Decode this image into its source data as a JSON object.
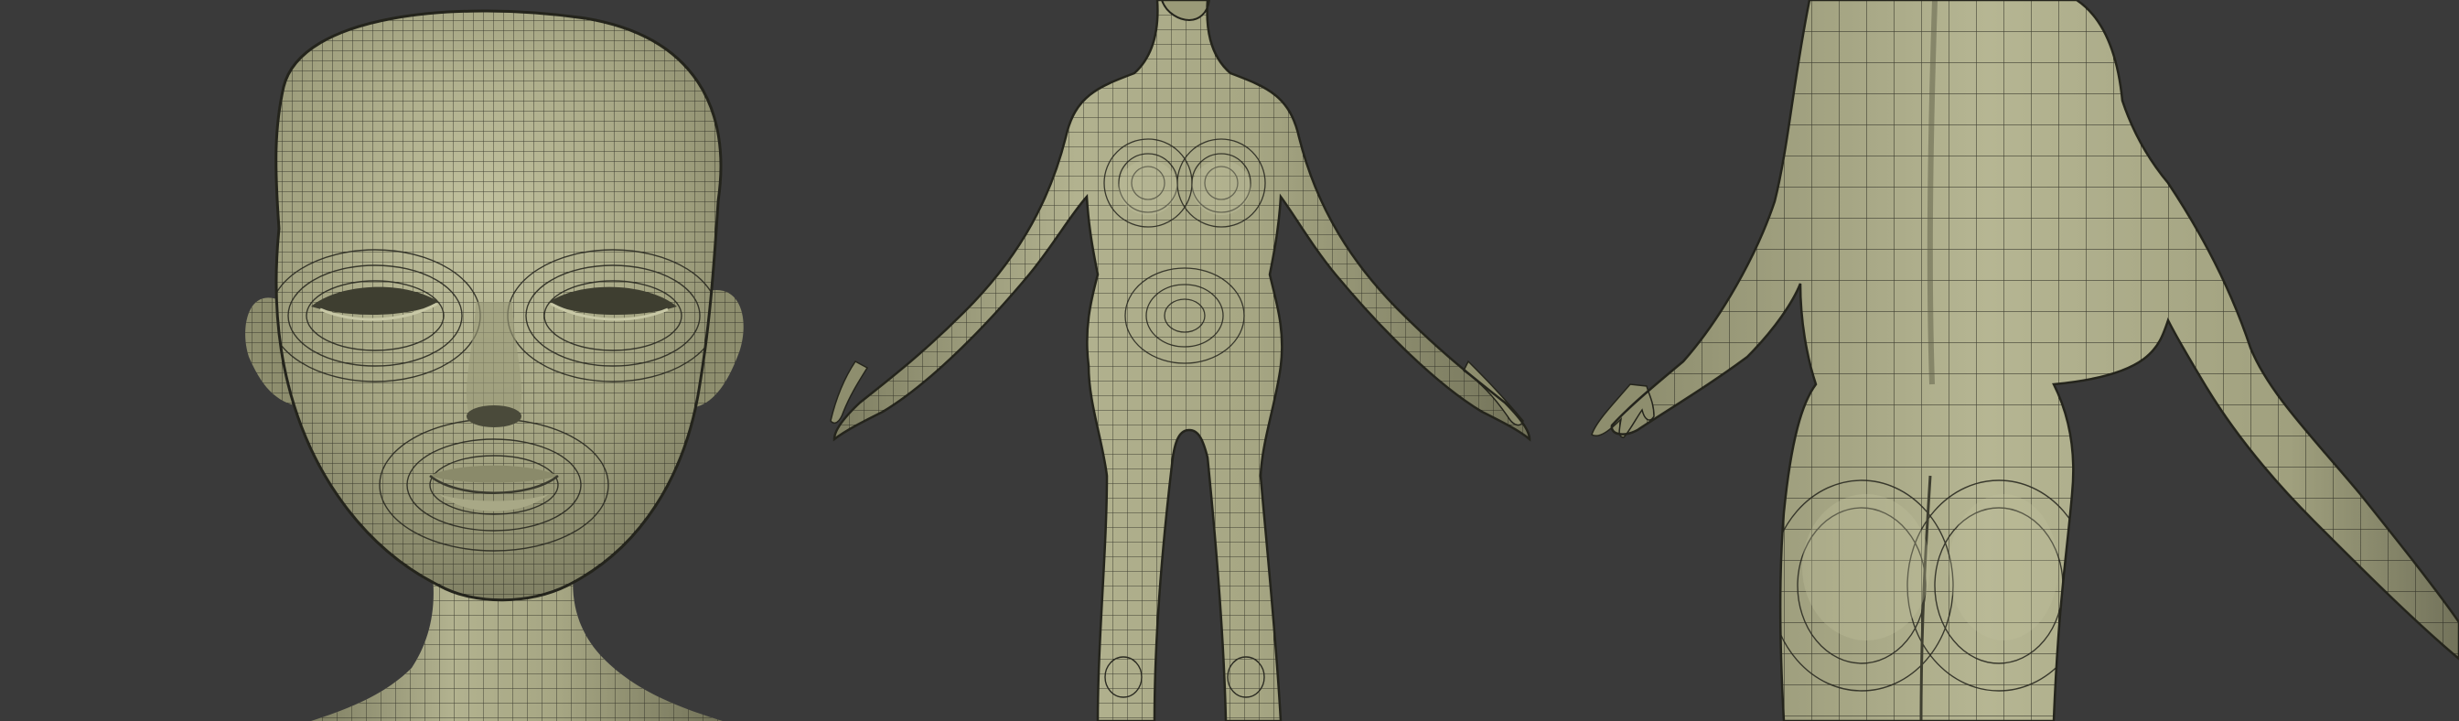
{
  "scene": {
    "background_color": "#3a3a3a",
    "clay_color": "#9c9c7a",
    "clay_highlight": "#b9b996",
    "clay_shadow": "#6b6b52",
    "wire_color": "#2a2a22",
    "views": [
      {
        "id": "head-view",
        "subject": "head-closeup"
      },
      {
        "id": "front-view",
        "subject": "full-body-front"
      },
      {
        "id": "back-view",
        "subject": "torso-back-three-quarter"
      }
    ]
  }
}
